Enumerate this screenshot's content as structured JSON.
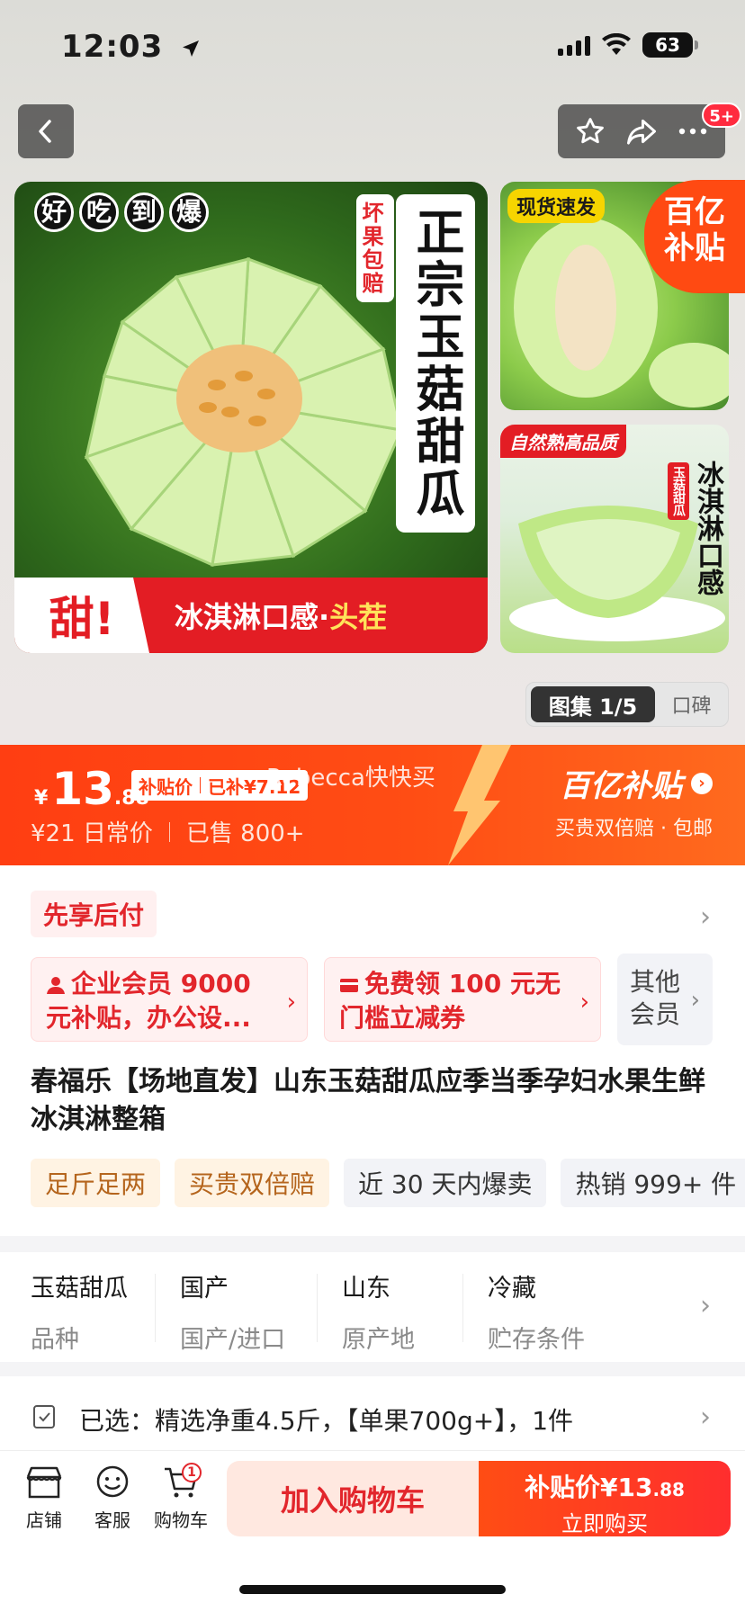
{
  "status_bar": {
    "time": "12:03",
    "battery": "63"
  },
  "nav": {
    "cart_badge": "5+"
  },
  "hero": {
    "main_image": {
      "top_chars": [
        "好",
        "吃",
        "到",
        "爆"
      ],
      "vertical_title": "正宗玉菇甜瓜",
      "vertical_tag": "坏果包赔",
      "banner_sweet": "甜!",
      "banner_text": "冰淇淋口感·",
      "banner_highlight": "头茬"
    },
    "side_image_1": {
      "tag": "现货速发"
    },
    "side_image_2": {
      "tag": "自然熟高品质",
      "vertical_text": "冰淇淋口感",
      "small_tag": "玉菇甜瓜"
    },
    "subsidy_corner": [
      "百亿",
      "补贴"
    ],
    "gallery": {
      "active": "图集 1/5",
      "other": "口碑"
    }
  },
  "price": {
    "currency": "¥",
    "integer": "13",
    "decimal": ".88",
    "chip_label": "补贴价",
    "chip_extra": "已补¥7.12",
    "original": "¥21 日常价",
    "sold": "已售 800+",
    "watermark": "Rebecca快快买",
    "subsidy_title": "百亿补贴",
    "subsidy_sub": "买贵双倍赔 · 包邮"
  },
  "pay_later": "先享后付",
  "coupons": [
    {
      "line1": "企业会员 9000",
      "line2": "元补贴，办公设..."
    },
    {
      "line1": "免费领 100 元无",
      "line2": "门槛立减券"
    }
  ],
  "coupon_other": {
    "line1": "其他",
    "line2": "会员"
  },
  "product_title": "春福乐【场地直发】山东玉菇甜瓜应季当季孕妇水果生鲜冰淇淋整箱",
  "tags": [
    {
      "text": "足斤足两",
      "style": "warm"
    },
    {
      "text": "买贵双倍赔",
      "style": "warm"
    },
    {
      "text": "近 30 天内爆卖",
      "style": "cool"
    },
    {
      "text": "热销 999+ 件",
      "style": "cool"
    }
  ],
  "specs": [
    {
      "value": "玉菇甜瓜",
      "key": "品种"
    },
    {
      "value": "国产",
      "key": "国产/进口"
    },
    {
      "value": "山东",
      "key": "原产地"
    },
    {
      "value": "冷藏",
      "key": "贮存条件"
    }
  ],
  "selected": "已选：精选净重4.5斤，【单果700g+】，1件",
  "bottom_bar": {
    "store": "店铺",
    "service": "客服",
    "cart": "购物车",
    "cart_count": "1",
    "add_to_cart": "加入购物车",
    "buy_label": "补贴价¥13",
    "buy_decimal": ".88",
    "buy_now": "立即购买"
  },
  "colors": {
    "accent": "#ff4d14",
    "red": "#e2262c",
    "band": "#ff3e12"
  }
}
